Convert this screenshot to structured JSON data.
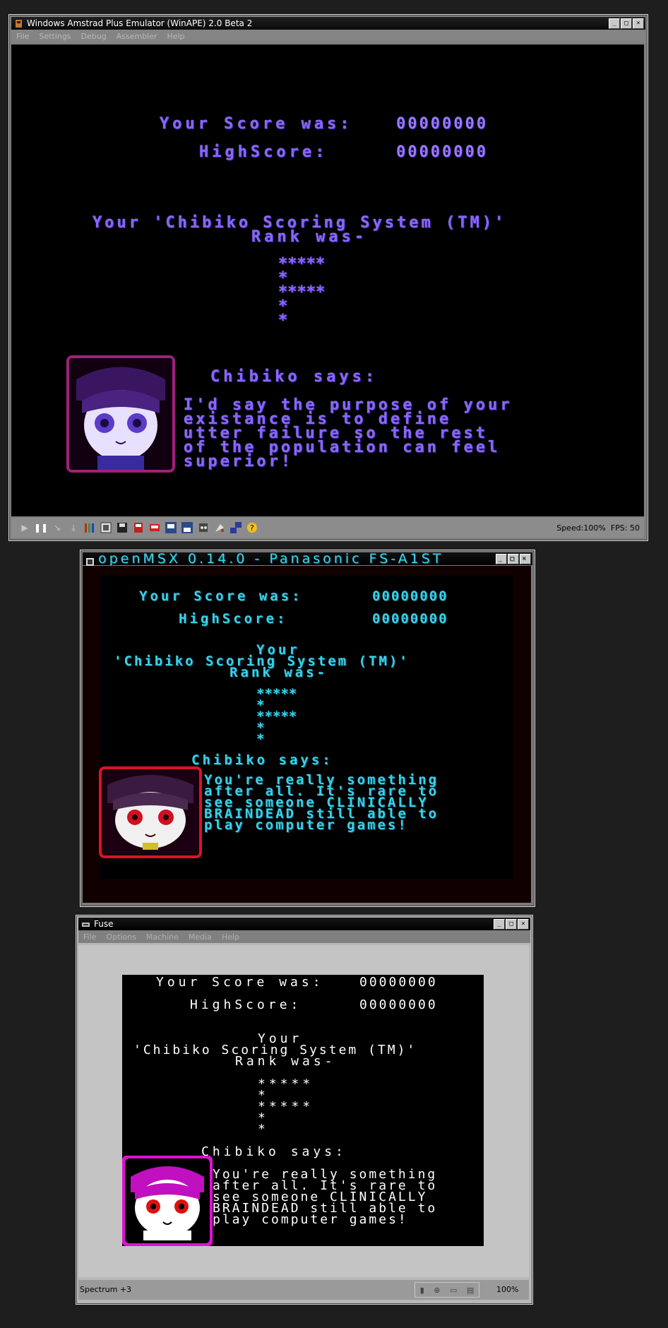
{
  "amstrad": {
    "title": "Windows Amstrad Plus Emulator (WinAPE) 2.0 Beta 2",
    "menu": [
      "File",
      "Settings",
      "Debug",
      "Assembler",
      "Help"
    ],
    "score_label": "Your Score was:",
    "score_value": "00000000",
    "highscore_label": "HighScore:",
    "highscore_value": "00000000",
    "rank_line1": "Your 'Chibiko Scoring System (TM)'",
    "rank_line2": "Rank was-",
    "rank_rows": [
      "*****",
      "*",
      "*****",
      "*",
      "*"
    ],
    "says_label": "Chibiko says:",
    "quote_lines": [
      "I'd say the purpose of your",
      "existance is to define",
      "utter failure so the rest",
      "of the population can feel",
      "superior!"
    ],
    "status": "Speed:100%  FPS: 50",
    "toolbar_icons": [
      "play-icon",
      "pause-icon",
      "step-icon",
      "step-over-icon",
      "pens-icon",
      "config-icon",
      "save-icon",
      "disk-a-icon",
      "disk-b-icon",
      "snapshot-icon",
      "snapshot-save-icon",
      "tape-icon",
      "settings-icon",
      "screen-icon",
      "help-icon"
    ]
  },
  "msx": {
    "title": "openMSX 0.14.0 - Panasonic FS-A1ST",
    "score_label": "Your Score was:",
    "score_value": "00000000",
    "highscore_label": "HighScore:",
    "highscore_value": "00000000",
    "rank_line0": "Your",
    "rank_line1": "'Chibiko Scoring System (TM)'",
    "rank_line2": "Rank was-",
    "rank_rows": [
      "*****",
      "*",
      "*****",
      "*",
      "*"
    ],
    "says_label": "Chibiko says:",
    "quote_lines": [
      "You're really something",
      "after all. It's rare to",
      "see someone CLINICALLY",
      "BRAINDEAD still able to",
      "play computer games!"
    ]
  },
  "fuse": {
    "title": "Fuse",
    "menu": [
      "File",
      "Options",
      "Machine",
      "Media",
      "Help"
    ],
    "score_label": "Your Score was:",
    "score_value": "00000000",
    "highscore_label": "HighScore:",
    "highscore_value": "00000000",
    "rank_line0": "Your",
    "rank_line1": "'Chibiko Scoring System (TM)'",
    "rank_line2": "Rank was-",
    "rank_rows": [
      "*****",
      "*",
      "*****",
      "*",
      "*"
    ],
    "says_label": "Chibiko says:",
    "quote_lines": [
      "You're really something",
      "after all. It's rare to",
      "see someone CLINICALLY",
      "BRAINDEAD still able to",
      "play computer games!"
    ],
    "status_left": "Spectrum +3",
    "status_right": "100%"
  },
  "window_buttons": {
    "minimize": "_",
    "maximize": "□",
    "close": "×"
  },
  "colors": {
    "amstrad_text": "#8866ff",
    "msx_text": "#3ad0e6",
    "fuse_text": "#ffffff",
    "amstrad_portrait_border": "#a0207a",
    "msx_portrait_border": "#e0102a",
    "fuse_portrait_border": "#e010d0"
  }
}
